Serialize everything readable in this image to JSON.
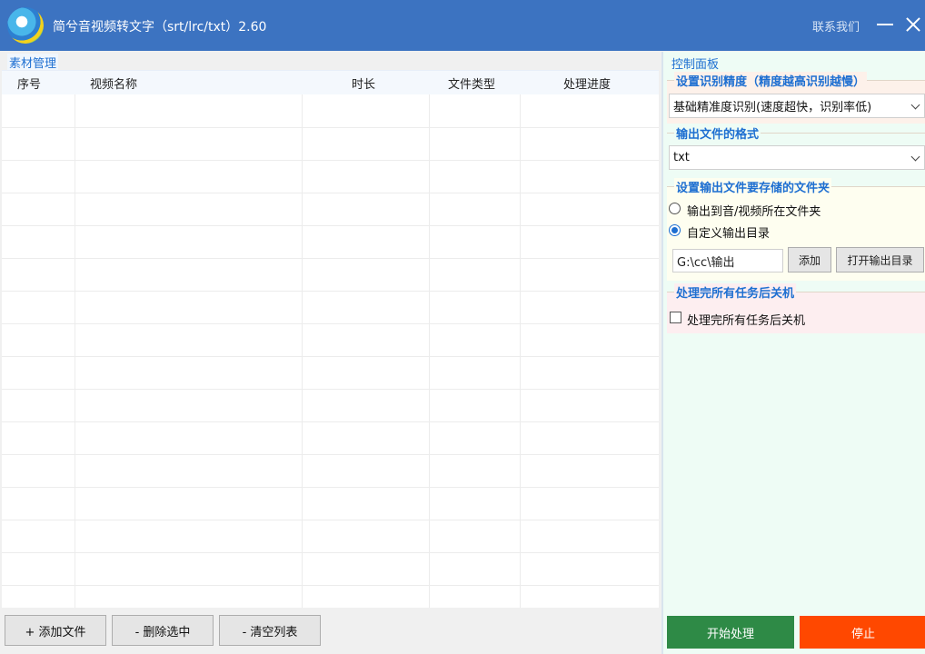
{
  "titlebar": {
    "title": "简兮音视频转文字（srt/lrc/txt）2.60",
    "contact_label": "联系我们"
  },
  "left_panel": {
    "group_label": "素材管理",
    "columns": [
      "序号",
      "视频名称",
      "时长",
      "文件类型",
      "处理进度"
    ],
    "buttons": {
      "add_file": "+ 添加文件",
      "delete_selected": "- 删除选中",
      "clear_list": "- 清空列表"
    }
  },
  "right_panel": {
    "title": "控制面板",
    "precision": {
      "label": "设置识别精度（精度越高识别越慢）",
      "selected": "基础精准度识别(速度超快，识别率低)"
    },
    "format": {
      "label": "输出文件的格式",
      "selected": "txt"
    },
    "output_folder": {
      "label": "设置输出文件要存储的文件夹",
      "option_source": "输出到音/视频所在文件夹",
      "option_custom": "自定义输出目录",
      "selected_option": "custom",
      "path_value": "G:\\cc\\输出",
      "add_button": "添加",
      "open_button": "打开输出目录"
    },
    "shutdown": {
      "label": "处理完所有任务后关机",
      "checkbox_label": "处理完所有任务后关机",
      "checked": false
    },
    "start_button": "开始处理",
    "stop_button": "停止"
  },
  "colors": {
    "titlebar": "#3c73c1",
    "accent": "#1e6fd1",
    "start": "#2e8a46",
    "stop": "#ff4800"
  }
}
